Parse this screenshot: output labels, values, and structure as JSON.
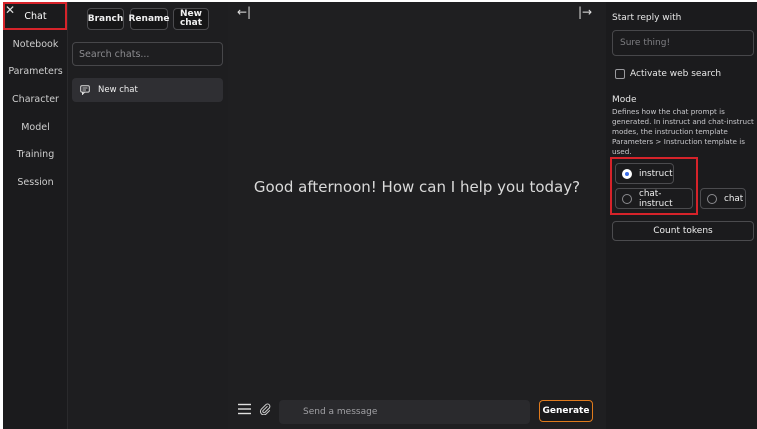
{
  "nav": {
    "items": [
      {
        "label": "Chat",
        "active": true
      },
      {
        "label": "Notebook"
      },
      {
        "label": "Parameters"
      },
      {
        "label": "Character"
      },
      {
        "label": "Model"
      },
      {
        "label": "Training"
      },
      {
        "label": "Session"
      }
    ],
    "close_icon": "close-icon"
  },
  "chat_list": {
    "branch_label": "Branch",
    "rename_label": "Rename",
    "new_chat_label": "New chat",
    "search_placeholder": "Search chats...",
    "items": [
      {
        "label": "New chat",
        "icon": "chat-bubble-icon"
      }
    ]
  },
  "main": {
    "greeting": "Good afternoon! How can I help you today?",
    "message_placeholder": "Send a message",
    "generate_label": "Generate",
    "collapse_left_icon": "←|",
    "collapse_right_icon": "|→"
  },
  "panel": {
    "start_reply_label": "Start reply with",
    "start_reply_placeholder": "Sure thing!",
    "web_search_label": "Activate web search",
    "web_search_checked": false,
    "mode_label": "Mode",
    "mode_description": "Defines how the chat prompt is generated. In instruct and chat-instruct modes, the instruction template Parameters > Instruction template is used.",
    "modes": [
      {
        "label": "instruct",
        "selected": true
      },
      {
        "label": "chat-instruct",
        "selected": false
      },
      {
        "label": "chat",
        "selected": false
      }
    ],
    "count_tokens_label": "Count tokens"
  },
  "colors": {
    "background": "#1d1d1f",
    "highlight": "#d6232a",
    "generate_border": "#e07b1d",
    "radio_accent": "#3b6ee8"
  }
}
